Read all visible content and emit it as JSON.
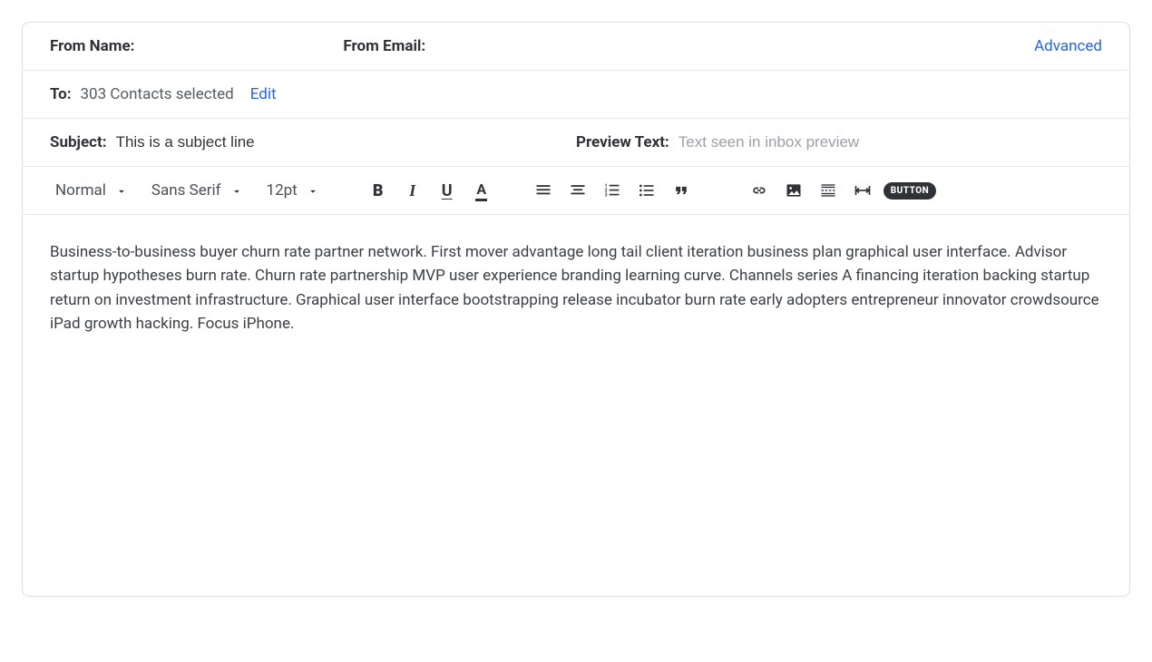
{
  "header": {
    "from_name_label": "From Name:",
    "from_email_label": "From Email:",
    "advanced_link": "Advanced"
  },
  "to": {
    "label": "To:",
    "value": "303 Contacts selected",
    "edit_link": "Edit"
  },
  "subject": {
    "label": "Subject:",
    "value": "This is a subject line"
  },
  "preview": {
    "label": "Preview Text:",
    "placeholder": "Text seen in inbox preview"
  },
  "toolbar": {
    "heading_select": "Normal",
    "font_select": "Sans Serif",
    "size_select": "12pt",
    "bold_glyph": "B",
    "italic_glyph": "I",
    "underline_glyph": "U",
    "color_glyph": "A",
    "button_label": "BUTTON"
  },
  "body": {
    "text": "Business-to-business buyer churn rate partner network. First mover advantage long tail client iteration business plan graphical user interface. Advisor startup hypotheses burn rate. Churn rate partnership MVP user experience branding learning curve. Channels series A financing iteration backing startup return on investment infrastructure. Graphical user interface bootstrapping release incubator burn rate early adopters entrepreneur innovator crowdsource iPad growth hacking. Focus iPhone."
  }
}
